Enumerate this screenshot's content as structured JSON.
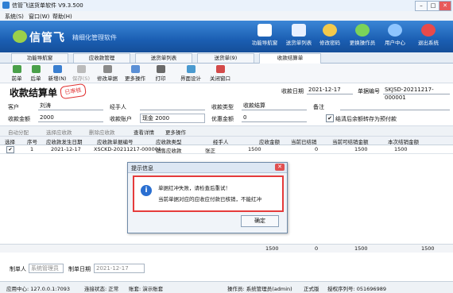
{
  "window": {
    "title": "信管飞送货单软件 V9.3.500",
    "min": "–",
    "max": "□",
    "close": "✕"
  },
  "menu": {
    "items": [
      "系统(S)",
      "窗口(W)",
      "帮助(H)"
    ]
  },
  "banner": {
    "logo": "信管飞",
    "subtitle": "精细化管理软件",
    "nav": [
      {
        "label": "功能导航窗",
        "color": "#ffffff"
      },
      {
        "label": "送货单列表",
        "color": "#e8f0ff"
      },
      {
        "label": "修改密码",
        "color": "#f2c94c"
      },
      {
        "label": "更换操作员",
        "color": "#7bd35a"
      },
      {
        "label": "用户中心",
        "color": "#8ec5ff"
      },
      {
        "label": "退出系统",
        "color": "#e84a4a"
      }
    ]
  },
  "tabs": [
    {
      "label": "功能导航窗"
    },
    {
      "label": "应收款管理"
    },
    {
      "label": "送货单列表"
    },
    {
      "label": "送货单(9)"
    },
    {
      "label": "收款结算单",
      "active": true
    }
  ],
  "toolbar": [
    {
      "label": "前单",
      "icon": "prev-icon"
    },
    {
      "label": "后单",
      "icon": "next-icon"
    },
    {
      "label": "新增(N)",
      "icon": "add-icon"
    },
    {
      "label": "保存(S)",
      "icon": "save-icon"
    },
    {
      "label": "修改单据",
      "icon": "edit-icon"
    },
    {
      "label": "更多操作",
      "icon": "more-icon"
    },
    {
      "label": "打印",
      "icon": "print-icon"
    },
    {
      "label": "界面设计",
      "icon": "design-icon"
    },
    {
      "label": "关闭窗口",
      "icon": "close-window-icon"
    }
  ],
  "form": {
    "title": "收款结算单",
    "stamp": "已审核",
    "date_label": "收款日期",
    "date": "2021-12-17",
    "no_label": "单据编号",
    "no": "SKJSD-20211217-000001",
    "customer_label": "客户",
    "customer": "刘涛",
    "handler_label": "经手人",
    "handler": "",
    "type_label": "收款类型",
    "type": "收款结算",
    "remark_label": "备注",
    "remark": "",
    "amount_label": "收款金额",
    "amount": "2000",
    "account_label": "收款账户",
    "account": "现金 2000",
    "discount_label": "优惠金额",
    "discount": "0",
    "prepaid_label": "结清后余额转存为预付款"
  },
  "subtoolbar": [
    "自动分配",
    "选择应收款",
    "删除应收款",
    "查看详情",
    "更多操作"
  ],
  "grid": {
    "headers": [
      "选择",
      "序号",
      "应收款发生日期",
      "应收款单据编号",
      "应收款类型",
      "经手人",
      "应收金额",
      "当前已结销",
      "当前可结销金额",
      "本次结销金额"
    ],
    "rows": [
      {
        "check": "✔",
        "no": "1",
        "date": "2021-12-17",
        "doc": "XSCKD-20211217-000001",
        "type": "销售应收款",
        "handler": "张正",
        "amount": "1500",
        "settled": "0",
        "available": "1500",
        "this": "1500"
      }
    ],
    "totals": {
      "amount": "1500",
      "settled": "0",
      "available": "1500",
      "this": "1500"
    }
  },
  "bottom": {
    "maker_label": "制单人",
    "maker": "系统管理员",
    "make_date_label": "制单日期",
    "make_date": "2021-12-17"
  },
  "status": {
    "app_center": "应用中心: 127.0.0.1:7093",
    "connect": "连接状态: 正常",
    "account": "账套: 演示账套",
    "operator": "操作员: 系统管理员(admin)",
    "version": "正式版",
    "license": "授权序列号: 051696989"
  },
  "dialog": {
    "title": "提示信息",
    "message1": "单据红冲失败，请检查后重试！",
    "message2": "当前单据对应的应收应付款已核销，不能红冲",
    "ok": "确定"
  }
}
